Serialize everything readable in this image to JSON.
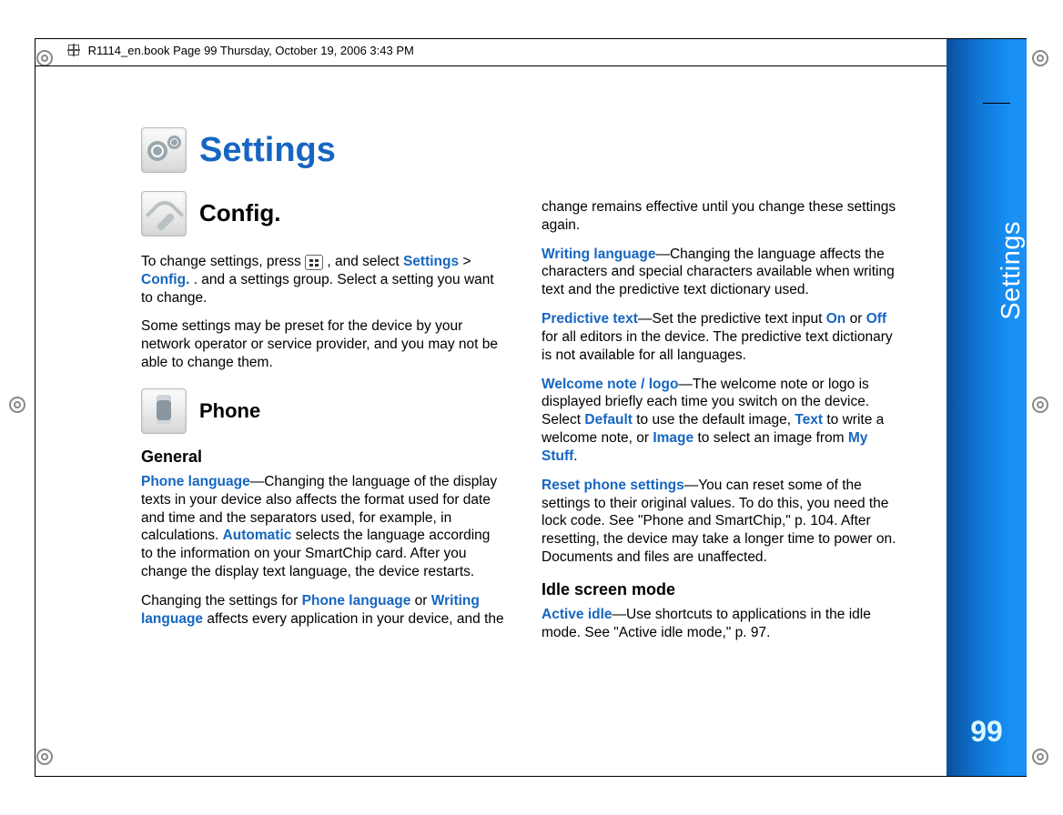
{
  "header_line": "R1114_en.book  Page 99  Thursday, October 19, 2006  3:43 PM",
  "side_tab": {
    "section": "Settings",
    "page_num": "99"
  },
  "title": "Settings",
  "config_heading": "Config.",
  "intro": {
    "p1_a": "To change settings, press ",
    "p1_b": " , and select ",
    "settings_link": "Settings",
    "gt": " > ",
    "config_link": "Config.",
    "p1_c": ". and a settings group. Select a setting you want to change.",
    "p2": "Some settings may be preset for the device by your network operator or service provider, and you may not be able to change them."
  },
  "phone_heading": "Phone",
  "general_heading": "General",
  "general": {
    "phone_language_label": "Phone language",
    "phone_language_text_a": "—Changing the language of the display texts in your device also affects the format used for date and time and the separators used, for example, in calculations. ",
    "automatic": "Automatic",
    "phone_language_text_b": " selects the language according to the information on your SmartChip card. After you change the display text language, the device restarts.",
    "changing_a": "Changing the settings for ",
    "pl2": "Phone language",
    "or": " or ",
    "wl": "Writing language",
    "changing_b": " affects every application in your device, and the "
  },
  "col2": {
    "cont": "change remains effective until you change these settings again.",
    "writing_language_label": "Writing language",
    "writing_language_text": "—Changing the language affects the characters and special characters available when writing text and the predictive text dictionary used.",
    "predictive_label": "Predictive text",
    "predictive_text_a": "—Set the predictive text input ",
    "on": "On",
    "or2": " or ",
    "off": "Off",
    "predictive_text_b": " for all editors in the device. The predictive text dictionary is not available for all languages.",
    "welcome_label": "Welcome note / logo",
    "welcome_a": "—The welcome note or logo is displayed briefly each time you switch on the device. Select ",
    "default": "Default",
    "welcome_b": " to use the default image, ",
    "text_opt": "Text",
    "welcome_c": " to write a welcome note, or ",
    "image_opt": "Image",
    "welcome_d": " to select an image from ",
    "mystuff": "My Stuff",
    "welcome_e": ".",
    "reset_label": "Reset phone settings",
    "reset_text": "—You can reset some of the settings to their original values. To do this, you need the lock code. See \"Phone and SmartChip,\" p. 104. After resetting, the device may take a longer time to power on. Documents and files are unaffected.",
    "idle_heading": "Idle screen mode",
    "active_idle_label": "Active idle",
    "active_idle_text": "—Use shortcuts to applications in the idle mode. See \"Active idle mode,\" p. 97."
  }
}
